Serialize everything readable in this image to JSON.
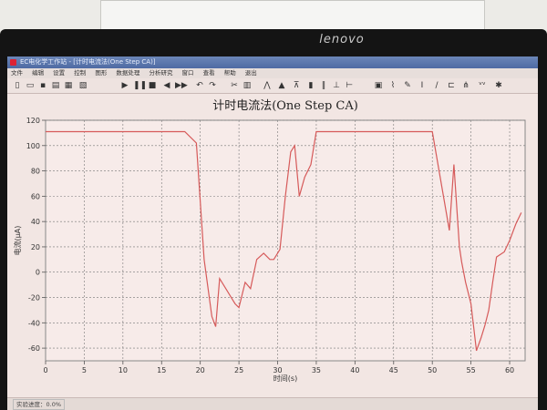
{
  "window": {
    "title": "EC电化学工作站 - [计时电流法(One Step CA)]"
  },
  "brand": "lenovo",
  "menu": {
    "items": [
      "文件",
      "编辑",
      "设置",
      "控制",
      "图形",
      "数据处理",
      "分析研究",
      "窗口",
      "查看",
      "帮助",
      "退出"
    ]
  },
  "toolbar": {
    "icons": [
      "new-file-icon",
      "open-folder-icon",
      "save-icon",
      "print-icon",
      "settings-icon",
      "play-icon",
      "pause-icon",
      "stop-icon",
      "step-back-icon",
      "step-forward-icon",
      "undo-icon",
      "redo-icon",
      "zoom-icon",
      "graph-icon",
      "tool-icon",
      "marker-icon",
      "color-icon",
      "peak-icon",
      "axis-icon",
      "cursor-icon",
      "brush-icon",
      "text-icon",
      "fit-icon",
      "data-icon"
    ]
  },
  "status": {
    "text": "实验进度：0.0%"
  },
  "chart_data": {
    "type": "line",
    "title": "计时电流法(One Step CA)",
    "xlabel": "时间(s)",
    "ylabel": "电流(μA)",
    "xlim": [
      0,
      62
    ],
    "ylim": [
      -70,
      120
    ],
    "xticks": [
      0,
      5,
      10,
      15,
      20,
      25,
      30,
      35,
      40,
      45,
      50,
      55,
      60
    ],
    "yticks": [
      -60,
      -40,
      -20,
      0,
      20,
      40,
      60,
      80,
      100,
      120
    ],
    "grid": true,
    "color": "#d65a5a",
    "x": [
      0,
      18,
      19.5,
      20.5,
      21.5,
      22,
      22.5,
      23.5,
      24.5,
      25,
      25.8,
      26.5,
      27.3,
      28.2,
      29,
      29.5,
      30.3,
      31,
      31.7,
      32.2,
      32.8,
      33.5,
      34.3,
      35,
      40,
      50,
      51.5,
      52.2,
      52.8,
      53.5,
      53.8,
      54.3,
      55,
      55.7,
      56.3,
      56.8,
      57.3,
      57.8,
      58.3,
      58.8,
      59.3,
      60,
      60.8,
      61.5
    ],
    "y": [
      111,
      111,
      102,
      10,
      -35,
      -43,
      -5,
      -15,
      -25,
      -28,
      -8,
      -13,
      10,
      15,
      10,
      10,
      18,
      60,
      95,
      100,
      60,
      75,
      85,
      111,
      111,
      111,
      58,
      33,
      85,
      20,
      8,
      -8,
      -25,
      -62,
      -52,
      -42,
      -30,
      -8,
      12,
      14,
      16,
      25,
      38,
      47
    ]
  }
}
